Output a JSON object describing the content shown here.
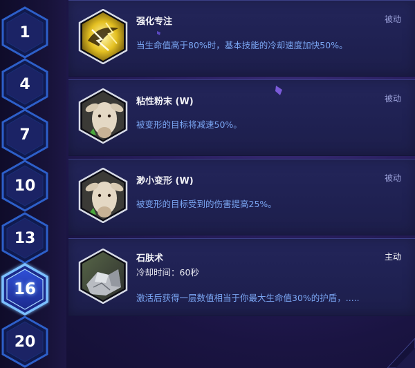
{
  "levels": [
    {
      "label": "1"
    },
    {
      "label": "4"
    },
    {
      "label": "7"
    },
    {
      "label": "10"
    },
    {
      "label": "13"
    },
    {
      "label": "16",
      "selected": true
    },
    {
      "label": "20"
    }
  ],
  "talents": [
    {
      "name": "强化专注",
      "type": "被动",
      "description": "当生命值高于80%时，基本技能的冷却速度加快50%。",
      "icon": "lightning-claw-icon"
    },
    {
      "name": "粘性粉末 (W)",
      "type": "被动",
      "description": "被变形的目标将减速50%。",
      "icon": "goat-polymorph-icon"
    },
    {
      "name": "渺小变形 (W)",
      "type": "被动",
      "description": "被变形的目标受到的伤害提高25%。",
      "icon": "goat-polymorph-icon"
    },
    {
      "name": "石肤术",
      "type": "主动",
      "cooldown": "冷却时间：60秒",
      "description": "激活后获得一层数值相当于你最大生命值30%的护盾，.....",
      "icon": "stone-skin-icon"
    }
  ],
  "colors": {
    "passive_type": "#9aa0d8",
    "active_type": "#ffffff",
    "description": "#7aa5f2",
    "selected_glow": "#5fa8ff",
    "hex_fill": "#1c2368",
    "hex_border": "#2f62c8"
  }
}
